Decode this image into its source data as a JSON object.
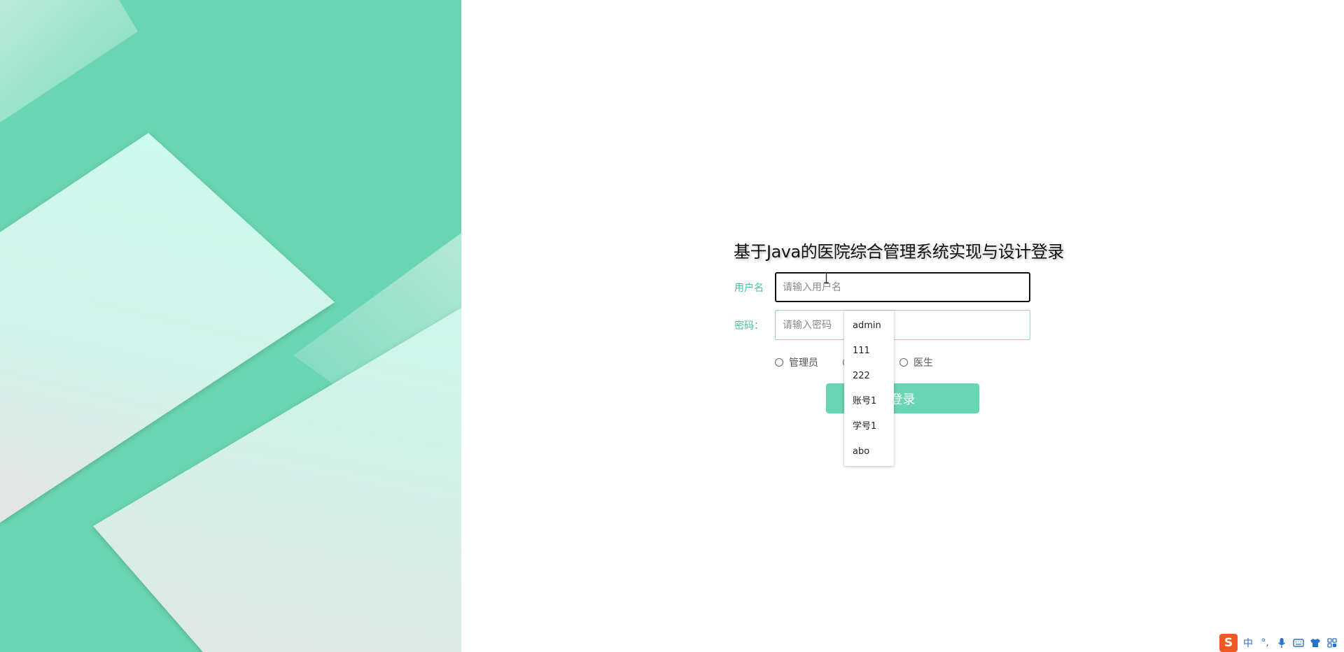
{
  "login": {
    "title": "基于Java的医院综合管理系统实现与设计登录",
    "username_label": "用户名",
    "username_placeholder": "请输入用户名",
    "password_label": "密码：",
    "password_placeholder": "请输入密码",
    "roles": [
      {
        "label": "管理员",
        "checked": false
      },
      {
        "label": "",
        "checked": false
      },
      {
        "label": "医生",
        "checked": false
      }
    ],
    "submit_label": "登录"
  },
  "autocomplete": {
    "items": [
      "admin",
      "111",
      "222",
      "账号1",
      "学号1",
      "abo"
    ]
  },
  "ime_toolbar": {
    "logo": "S",
    "mode": "中",
    "punct": "°,",
    "icons": [
      "microphone-icon",
      "keyboard-icon",
      "skin-shirt-icon",
      "toolbox-grid-icon"
    ]
  },
  "colors": {
    "accent": "#6ad5b2",
    "label_text": "#44c498",
    "ime_logo": "#ef5a24",
    "ime_icons": "#2a6fc9"
  }
}
